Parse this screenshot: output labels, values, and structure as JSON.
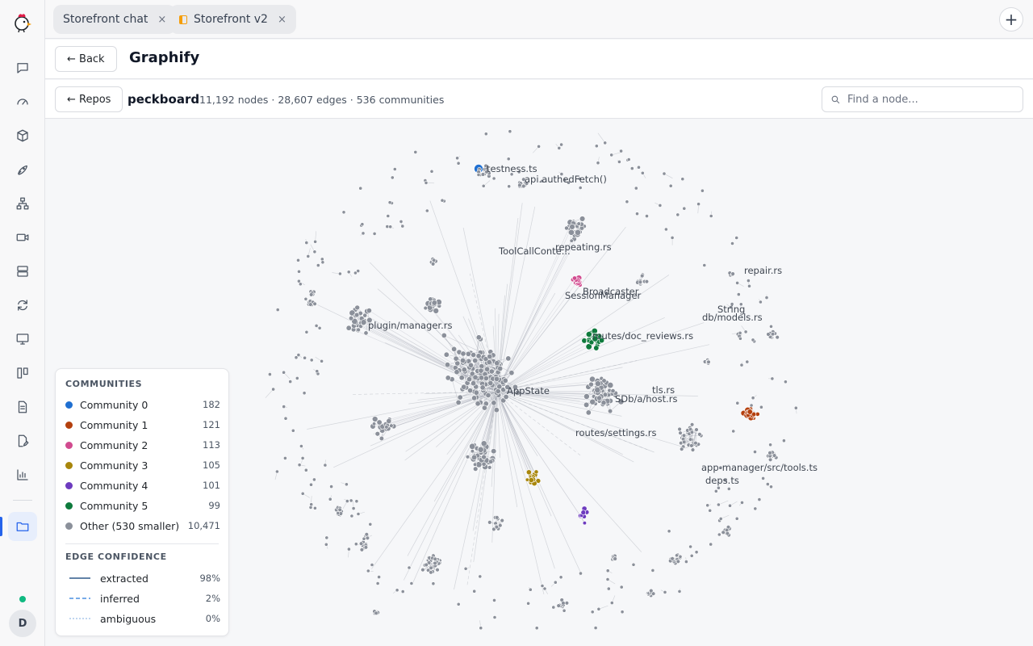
{
  "tabs": [
    {
      "label": "Storefront chat",
      "close": "×"
    },
    {
      "label": "Storefront v2",
      "close": "×"
    }
  ],
  "new_tab": "+",
  "header": {
    "back_label": "← Back",
    "title": "Graphify"
  },
  "subheader": {
    "repos_label": "← Repos",
    "repo_name": "peckboard",
    "stats": "11,192 nodes · 28,607 edges · 536 communities",
    "search_placeholder": "Find a node..."
  },
  "user": {
    "initial": "D"
  },
  "legend": {
    "communities_title": "COMMUNITIES",
    "communities": [
      {
        "name": "Community 0",
        "count": "182",
        "color": "#1f6fd1"
      },
      {
        "name": "Community 1",
        "count": "121",
        "color": "#b4400e"
      },
      {
        "name": "Community 2",
        "count": "113",
        "color": "#d14b8f"
      },
      {
        "name": "Community 3",
        "count": "105",
        "color": "#a8860b"
      },
      {
        "name": "Community 4",
        "count": "101",
        "color": "#6d3bbf"
      },
      {
        "name": "Community 5",
        "count": "99",
        "color": "#0e7a3c"
      },
      {
        "name": "Other (530 smaller)",
        "count": "10,471",
        "color": "#8b909a"
      }
    ],
    "edge_title": "EDGE CONFIDENCE",
    "edges": [
      {
        "name": "extracted",
        "pct": "98%",
        "style": "solid"
      },
      {
        "name": "inferred",
        "pct": "2%",
        "style": "dashed"
      },
      {
        "name": "ambiguous",
        "pct": "0%",
        "style": "dotted"
      }
    ]
  },
  "graph_labels": [
    "testness.ts",
    "api.authedFetch()",
    "repeating.rs",
    "ToolCallConte...",
    "Broadcaster",
    "SessionManager",
    "repair.rs",
    "String",
    "db/models.rs",
    "plugin/manager.rs",
    "routes/doc_reviews.rs",
    "AppState",
    "tls.rs",
    "SDb/a/host.rs",
    "routes/settings.rs",
    "app-manager/src/tools.ts",
    "deps.ts"
  ]
}
